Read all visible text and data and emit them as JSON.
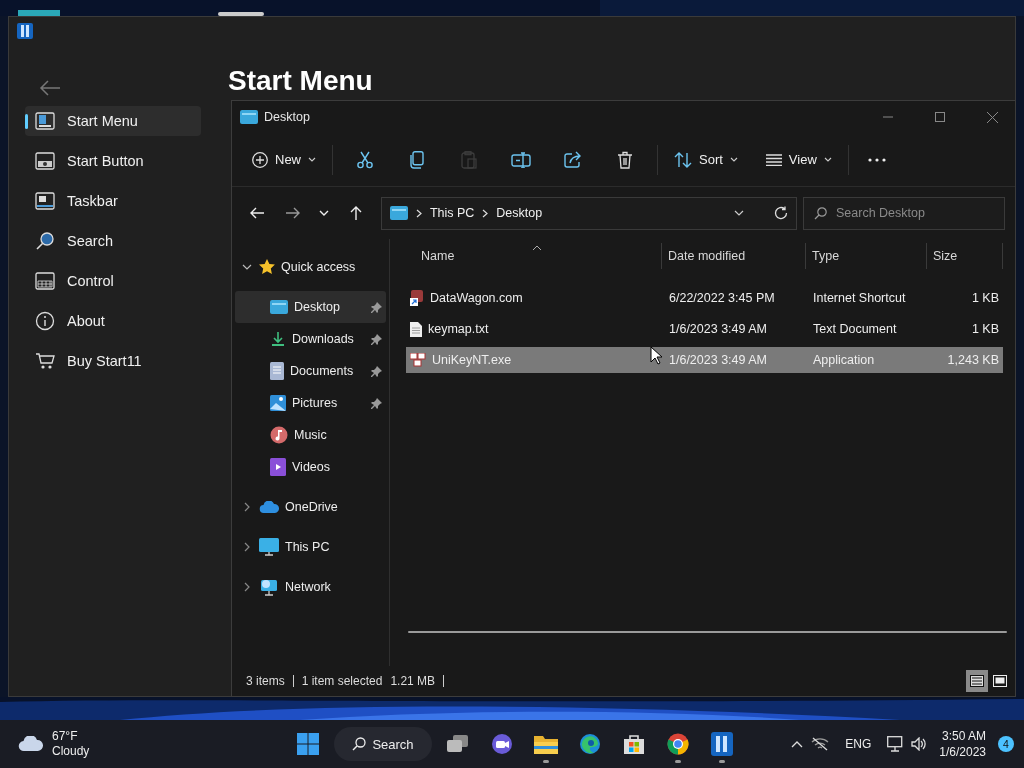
{
  "start11": {
    "title": "Start Menu",
    "nav": [
      {
        "label": "Start Menu",
        "selected": true
      },
      {
        "label": "Start Button",
        "selected": false
      },
      {
        "label": "Taskbar",
        "selected": false
      },
      {
        "label": "Search",
        "selected": false
      },
      {
        "label": "Control",
        "selected": false
      },
      {
        "label": "About",
        "selected": false
      },
      {
        "label": "Buy Start11",
        "selected": false
      }
    ]
  },
  "explorer": {
    "title": "Desktop",
    "new_label": "New",
    "sort_label": "Sort",
    "view_label": "View",
    "tools": [
      {
        "disabled": false
      },
      {
        "disabled": false
      },
      {
        "disabled": true
      },
      {
        "disabled": false
      },
      {
        "disabled": false
      },
      {
        "disabled": false
      }
    ],
    "crumbs": [
      "This PC",
      "Desktop"
    ],
    "search": {
      "placeholder": "Search Desktop"
    },
    "nav_pane": [
      {
        "label": "Quick access",
        "expanded": true,
        "children": [
          {
            "label": "Desktop",
            "pinned": true,
            "selected": true
          },
          {
            "label": "Downloads",
            "pinned": true,
            "selected": false
          },
          {
            "label": "Documents",
            "pinned": true,
            "selected": false
          },
          {
            "label": "Pictures",
            "pinned": true,
            "selected": false
          },
          {
            "label": "Music",
            "pinned": false,
            "selected": false
          },
          {
            "label": "Videos",
            "pinned": false,
            "selected": false
          }
        ]
      },
      {
        "label": "OneDrive",
        "expanded": false
      },
      {
        "label": "This PC",
        "expanded": false
      },
      {
        "label": "Network",
        "expanded": false
      }
    ],
    "columns": [
      "Name",
      "Date modified",
      "Type",
      "Size"
    ],
    "files": [
      {
        "name": "DataWagon.com",
        "date": "6/22/2022 3:45 PM",
        "type": "Internet Shortcut",
        "size": "1 KB",
        "selected": false
      },
      {
        "name": "keymap.txt",
        "date": "1/6/2023 3:49 AM",
        "type": "Text Document",
        "size": "1 KB",
        "selected": false
      },
      {
        "name": "UniKeyNT.exe",
        "date": "1/6/2023 3:49 AM",
        "type": "Application",
        "size": "1,243 KB",
        "selected": true
      }
    ],
    "status": {
      "count": "3 items",
      "selection": "1 item selected",
      "size": "1.21 MB"
    },
    "views": [
      {
        "selected": true
      },
      {
        "selected": false
      }
    ]
  },
  "taskbar": {
    "weather": {
      "temp": "67°F",
      "condition": "Cloudy"
    },
    "search_label": "Search",
    "apps": [
      {
        "running": false
      },
      {
        "running": false
      },
      {
        "running": true
      },
      {
        "running": false
      },
      {
        "running": false
      },
      {
        "running": true
      },
      {
        "running": true
      }
    ],
    "language": "ENG",
    "time": "3:50 AM",
    "date": "1/6/2023",
    "badge": "4"
  }
}
